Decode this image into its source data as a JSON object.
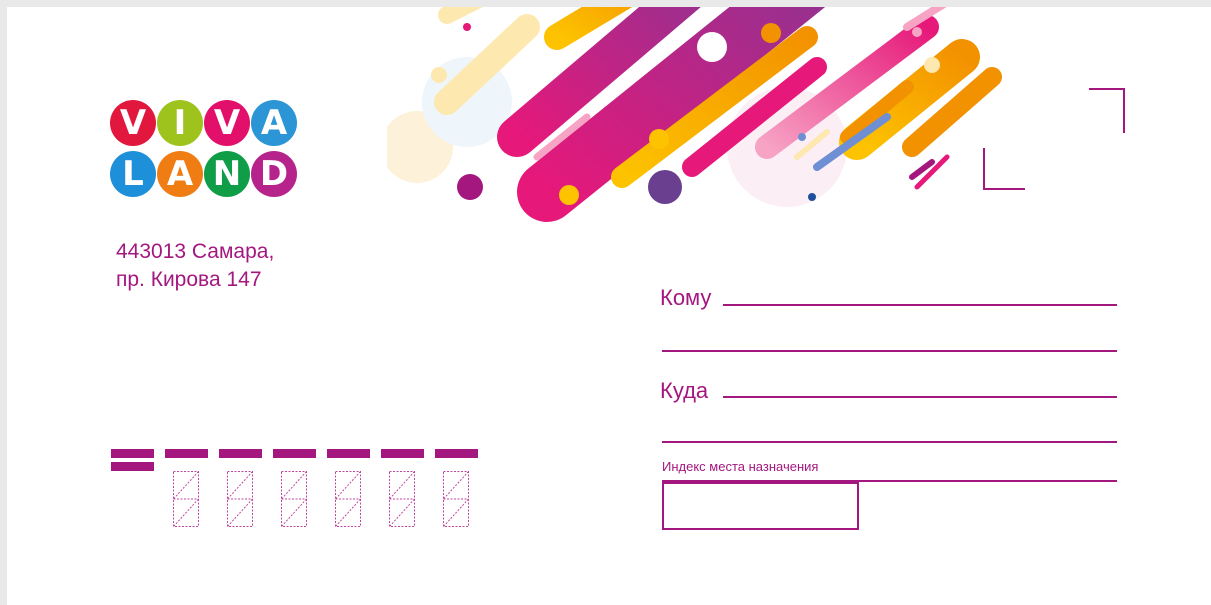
{
  "logo": {
    "row1": [
      {
        "letter": "V",
        "color": "#e2173d"
      },
      {
        "letter": "I",
        "color": "#9ec31d"
      },
      {
        "letter": "V",
        "color": "#e3106b"
      },
      {
        "letter": "A",
        "color": "#2b95d6"
      }
    ],
    "row2": [
      {
        "letter": "L",
        "color": "#1e8fd9"
      },
      {
        "letter": "A",
        "color": "#f07d14"
      },
      {
        "letter": "N",
        "color": "#0f9d48"
      },
      {
        "letter": "D",
        "color": "#b6248b"
      }
    ]
  },
  "sender": {
    "line1": "443013 Самара,",
    "line2": "пр. Кирова 147"
  },
  "recipient": {
    "to_label": "Кому",
    "where_label": "Куда",
    "index_label": "Индекс места назначения"
  },
  "colors": {
    "accent": "#a4177f",
    "magenta": "#e6187a",
    "orange": "#f39200",
    "yellow": "#fdc300",
    "purple": "#8e3392"
  }
}
